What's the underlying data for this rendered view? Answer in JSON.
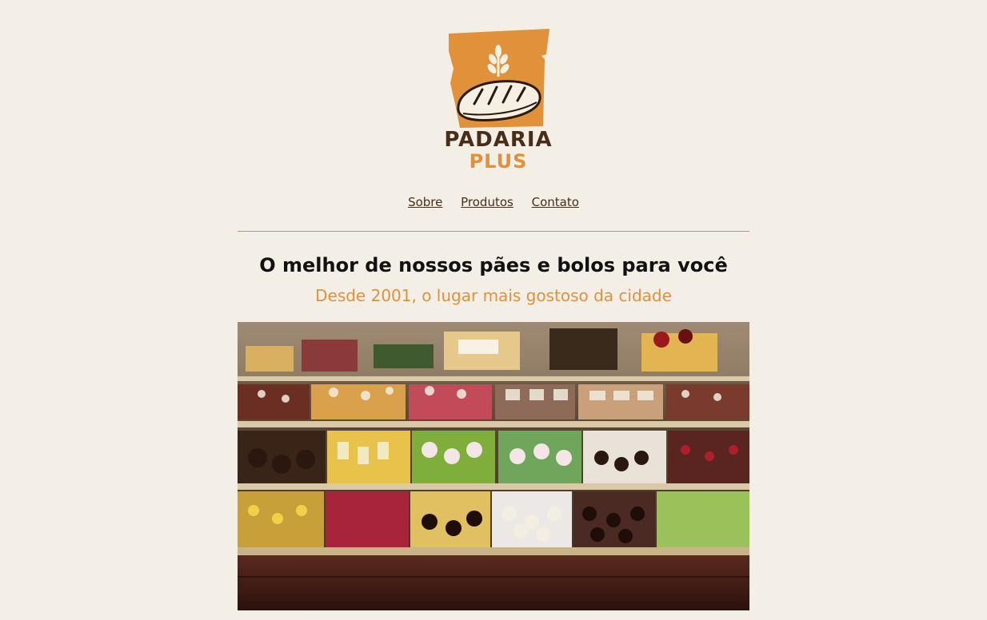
{
  "brand": {
    "name_line1": "PADARIA",
    "name_line2": "PLUS",
    "logo_icon": "bread-wheat-icon",
    "colors": {
      "primary": "#e0913a",
      "dark": "#4a2d17",
      "background": "#f4efe6"
    }
  },
  "nav": {
    "items": [
      {
        "label": "Sobre"
      },
      {
        "label": "Produtos"
      },
      {
        "label": "Contato"
      }
    ]
  },
  "hero": {
    "headline": "O melhor de nossos pães e bolos para você",
    "subheadline": "Desde 2001, o lugar mais gostoso da cidade",
    "image_subject": "pastry-display-case"
  }
}
